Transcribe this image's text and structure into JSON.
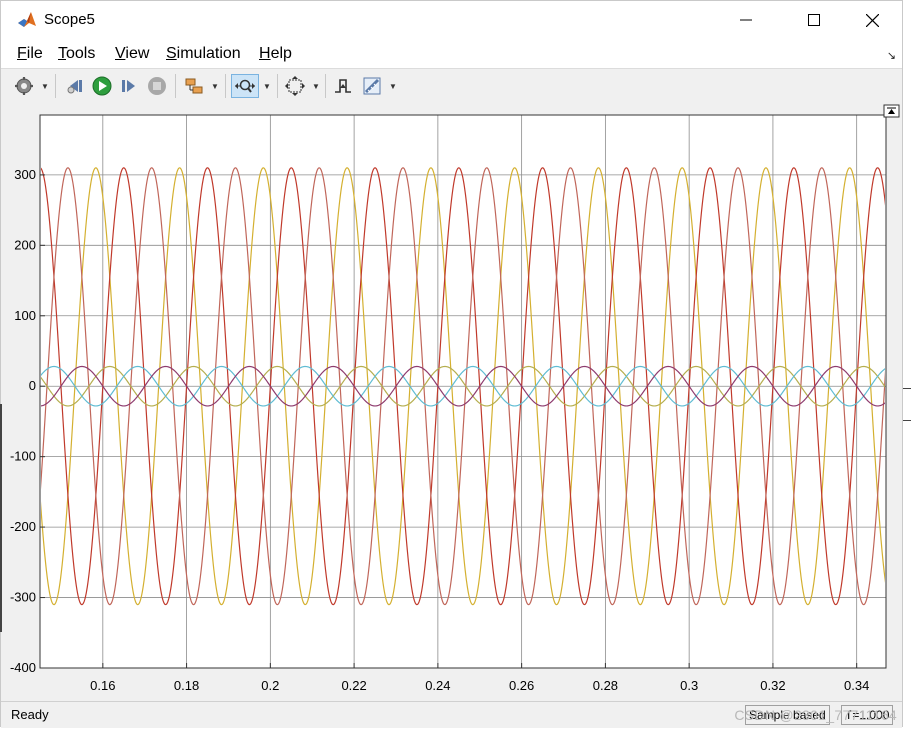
{
  "window": {
    "title": "Scope5",
    "app_icon": "matlab-icon"
  },
  "title_buttons": [
    "minimize-icon",
    "maximize-icon",
    "close-icon"
  ],
  "menu": [
    {
      "id": "file",
      "accel": "F",
      "rest": "ile"
    },
    {
      "id": "tools",
      "accel": "T",
      "rest": "ools"
    },
    {
      "id": "view",
      "accel": "V",
      "rest": "iew"
    },
    {
      "id": "simulation",
      "accel": "S",
      "rest": "imulation"
    },
    {
      "id": "help",
      "accel": "H",
      "rest": "elp"
    }
  ],
  "toolbar_icons": [
    "settings-gear-icon",
    "step-back-icon",
    "run-icon",
    "step-forward-icon",
    "stop-icon",
    "highlight-simulink-block-icon",
    "zoom-icon",
    "autoscale-icon",
    "triggers-icon",
    "measurements-icon"
  ],
  "chart_data": {
    "type": "line",
    "xlim": [
      0.145,
      0.347
    ],
    "ylim": [
      -400,
      385
    ],
    "x_ticks": [
      0.16,
      0.18,
      0.2,
      0.22,
      0.24,
      0.26,
      0.28,
      0.3,
      0.32,
      0.34
    ],
    "x_tick_labels": [
      "0.16",
      "0.18",
      "0.2",
      "0.22",
      "0.24",
      "0.26",
      "0.28",
      "0.3",
      "0.32",
      "0.34"
    ],
    "y_ticks": [
      -400,
      -300,
      -200,
      -100,
      0,
      100,
      200,
      300
    ],
    "y_tick_labels": [
      "-400",
      "-300",
      "-200",
      "-100",
      "0",
      "100",
      "200",
      "300"
    ],
    "grid": true,
    "series": [
      {
        "color": "#d4b030",
        "amplitude": 310,
        "frequency_hz": 50,
        "phase_deg": 120
      },
      {
        "color": "#c0392b",
        "amplitude": 310,
        "frequency_hz": 50,
        "phase_deg": 0
      },
      {
        "color": "#c0665a",
        "amplitude": 310,
        "frequency_hz": 50,
        "phase_deg": -120
      },
      {
        "color": "#b5ae4e",
        "amplitude": 28,
        "frequency_hz": 50,
        "phase_deg": 60
      },
      {
        "color": "#5fbcd3",
        "amplitude": 28,
        "frequency_hz": 50,
        "phase_deg": -60
      },
      {
        "color": "#8e3b6e",
        "amplitude": 28,
        "frequency_hz": 50,
        "phase_deg": 180
      }
    ]
  },
  "status": {
    "text": "Ready",
    "mode": "Sample based",
    "time": "T=1.000"
  },
  "watermark": "CSDN @2301_77711164"
}
